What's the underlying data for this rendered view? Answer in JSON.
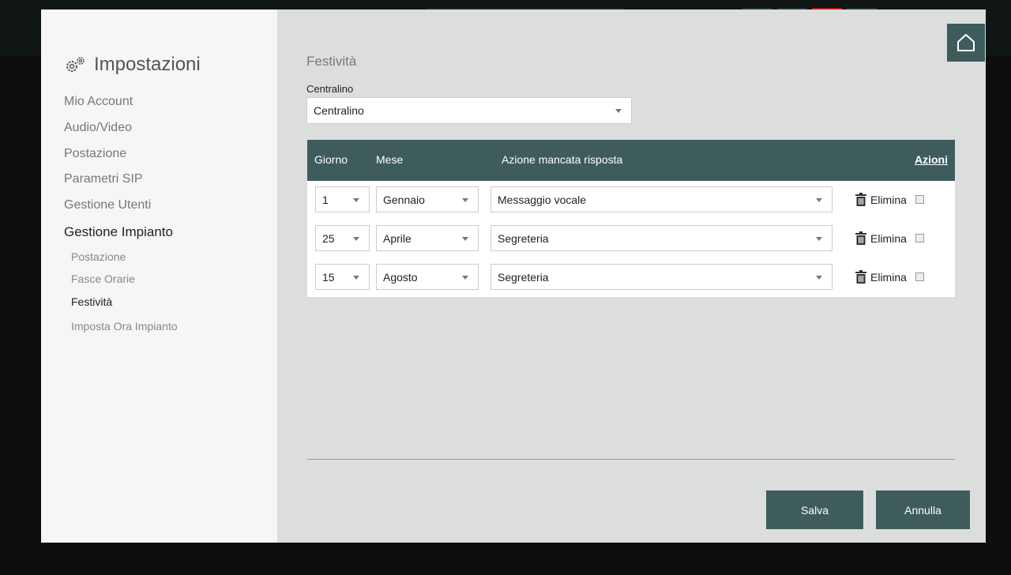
{
  "sidebar": {
    "title": "Impostazioni",
    "items": [
      {
        "label": "Mio Account"
      },
      {
        "label": "Audio/Video"
      },
      {
        "label": "Postazione"
      },
      {
        "label": "Parametri SIP"
      },
      {
        "label": "Gestione Utenti"
      },
      {
        "label": "Gestione Impianto"
      }
    ],
    "subitems": [
      {
        "label": "Postazione"
      },
      {
        "label": "Fasce Orarie"
      },
      {
        "label": "Festività"
      },
      {
        "label": "Imposta Ora Impianto"
      }
    ]
  },
  "main": {
    "title": "Festività",
    "centralino_label": "Centralino",
    "centralino_value": "Centralino",
    "table": {
      "headers": {
        "giorno": "Giorno",
        "mese": "Mese",
        "azione": "Azione mancata risposta",
        "azioni": "Azioni"
      },
      "rows": [
        {
          "giorno": "1",
          "mese": "Gennaio",
          "azione": "Messaggio vocale",
          "delete": "Elimina"
        },
        {
          "giorno": "25",
          "mese": "Aprile",
          "azione": "Segreteria",
          "delete": "Elimina"
        },
        {
          "giorno": "15",
          "mese": "Agosto",
          "azione": "Segreteria",
          "delete": "Elimina"
        }
      ]
    },
    "buttons": {
      "save": "Salva",
      "cancel": "Annulla"
    }
  },
  "icons": {
    "title_icon": "gears-icon",
    "home": "home-icon",
    "delete": "trash-icon"
  },
  "colors": {
    "accent": "#3e5c5c",
    "sidebar_bg": "#f5f6f5",
    "main_bg": "#dcdedd"
  }
}
